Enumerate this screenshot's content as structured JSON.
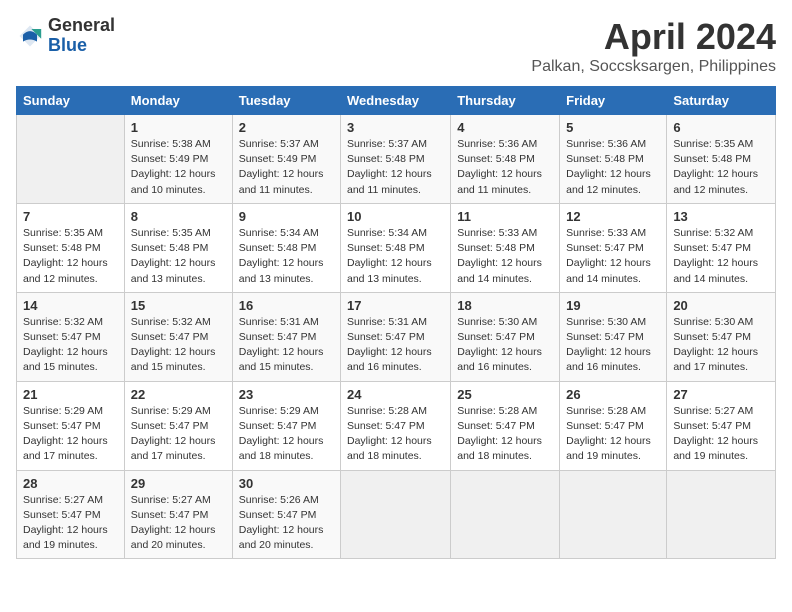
{
  "logo": {
    "general": "General",
    "blue": "Blue"
  },
  "title": "April 2024",
  "location": "Palkan, Soccsksargen, Philippines",
  "days_header": [
    "Sunday",
    "Monday",
    "Tuesday",
    "Wednesday",
    "Thursday",
    "Friday",
    "Saturday"
  ],
  "weeks": [
    [
      {
        "num": "",
        "info": ""
      },
      {
        "num": "1",
        "info": "Sunrise: 5:38 AM\nSunset: 5:49 PM\nDaylight: 12 hours\nand 10 minutes."
      },
      {
        "num": "2",
        "info": "Sunrise: 5:37 AM\nSunset: 5:49 PM\nDaylight: 12 hours\nand 11 minutes."
      },
      {
        "num": "3",
        "info": "Sunrise: 5:37 AM\nSunset: 5:48 PM\nDaylight: 12 hours\nand 11 minutes."
      },
      {
        "num": "4",
        "info": "Sunrise: 5:36 AM\nSunset: 5:48 PM\nDaylight: 12 hours\nand 11 minutes."
      },
      {
        "num": "5",
        "info": "Sunrise: 5:36 AM\nSunset: 5:48 PM\nDaylight: 12 hours\nand 12 minutes."
      },
      {
        "num": "6",
        "info": "Sunrise: 5:35 AM\nSunset: 5:48 PM\nDaylight: 12 hours\nand 12 minutes."
      }
    ],
    [
      {
        "num": "7",
        "info": "Sunrise: 5:35 AM\nSunset: 5:48 PM\nDaylight: 12 hours\nand 12 minutes."
      },
      {
        "num": "8",
        "info": "Sunrise: 5:35 AM\nSunset: 5:48 PM\nDaylight: 12 hours\nand 13 minutes."
      },
      {
        "num": "9",
        "info": "Sunrise: 5:34 AM\nSunset: 5:48 PM\nDaylight: 12 hours\nand 13 minutes."
      },
      {
        "num": "10",
        "info": "Sunrise: 5:34 AM\nSunset: 5:48 PM\nDaylight: 12 hours\nand 13 minutes."
      },
      {
        "num": "11",
        "info": "Sunrise: 5:33 AM\nSunset: 5:48 PM\nDaylight: 12 hours\nand 14 minutes."
      },
      {
        "num": "12",
        "info": "Sunrise: 5:33 AM\nSunset: 5:47 PM\nDaylight: 12 hours\nand 14 minutes."
      },
      {
        "num": "13",
        "info": "Sunrise: 5:32 AM\nSunset: 5:47 PM\nDaylight: 12 hours\nand 14 minutes."
      }
    ],
    [
      {
        "num": "14",
        "info": "Sunrise: 5:32 AM\nSunset: 5:47 PM\nDaylight: 12 hours\nand 15 minutes."
      },
      {
        "num": "15",
        "info": "Sunrise: 5:32 AM\nSunset: 5:47 PM\nDaylight: 12 hours\nand 15 minutes."
      },
      {
        "num": "16",
        "info": "Sunrise: 5:31 AM\nSunset: 5:47 PM\nDaylight: 12 hours\nand 15 minutes."
      },
      {
        "num": "17",
        "info": "Sunrise: 5:31 AM\nSunset: 5:47 PM\nDaylight: 12 hours\nand 16 minutes."
      },
      {
        "num": "18",
        "info": "Sunrise: 5:30 AM\nSunset: 5:47 PM\nDaylight: 12 hours\nand 16 minutes."
      },
      {
        "num": "19",
        "info": "Sunrise: 5:30 AM\nSunset: 5:47 PM\nDaylight: 12 hours\nand 16 minutes."
      },
      {
        "num": "20",
        "info": "Sunrise: 5:30 AM\nSunset: 5:47 PM\nDaylight: 12 hours\nand 17 minutes."
      }
    ],
    [
      {
        "num": "21",
        "info": "Sunrise: 5:29 AM\nSunset: 5:47 PM\nDaylight: 12 hours\nand 17 minutes."
      },
      {
        "num": "22",
        "info": "Sunrise: 5:29 AM\nSunset: 5:47 PM\nDaylight: 12 hours\nand 17 minutes."
      },
      {
        "num": "23",
        "info": "Sunrise: 5:29 AM\nSunset: 5:47 PM\nDaylight: 12 hours\nand 18 minutes."
      },
      {
        "num": "24",
        "info": "Sunrise: 5:28 AM\nSunset: 5:47 PM\nDaylight: 12 hours\nand 18 minutes."
      },
      {
        "num": "25",
        "info": "Sunrise: 5:28 AM\nSunset: 5:47 PM\nDaylight: 12 hours\nand 18 minutes."
      },
      {
        "num": "26",
        "info": "Sunrise: 5:28 AM\nSunset: 5:47 PM\nDaylight: 12 hours\nand 19 minutes."
      },
      {
        "num": "27",
        "info": "Sunrise: 5:27 AM\nSunset: 5:47 PM\nDaylight: 12 hours\nand 19 minutes."
      }
    ],
    [
      {
        "num": "28",
        "info": "Sunrise: 5:27 AM\nSunset: 5:47 PM\nDaylight: 12 hours\nand 19 minutes."
      },
      {
        "num": "29",
        "info": "Sunrise: 5:27 AM\nSunset: 5:47 PM\nDaylight: 12 hours\nand 20 minutes."
      },
      {
        "num": "30",
        "info": "Sunrise: 5:26 AM\nSunset: 5:47 PM\nDaylight: 12 hours\nand 20 minutes."
      },
      {
        "num": "",
        "info": ""
      },
      {
        "num": "",
        "info": ""
      },
      {
        "num": "",
        "info": ""
      },
      {
        "num": "",
        "info": ""
      }
    ]
  ]
}
